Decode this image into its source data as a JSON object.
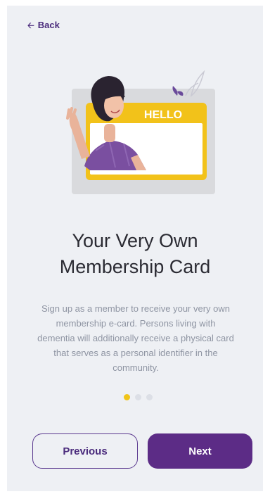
{
  "nav": {
    "back_label": "Back",
    "back_icon": "arrow-left-icon"
  },
  "illustration": {
    "card_text": "HELLO"
  },
  "onboarding": {
    "title_line1": "Your Very Own",
    "title_line2": "Membership Card",
    "description": "Sign up as a member to receive your very own membership e-card. Persons living with dementia will additionally receive a physical card that serves as a personal identifier in the community.",
    "current_page": 1,
    "total_pages": 3
  },
  "actions": {
    "previous_label": "Previous",
    "next_label": "Next"
  },
  "colors": {
    "accent_purple": "#5c2c86",
    "accent_yellow": "#f0c419",
    "background": "#eef0f4",
    "text_dark": "#2b2b33",
    "text_muted": "#8f95a3"
  }
}
